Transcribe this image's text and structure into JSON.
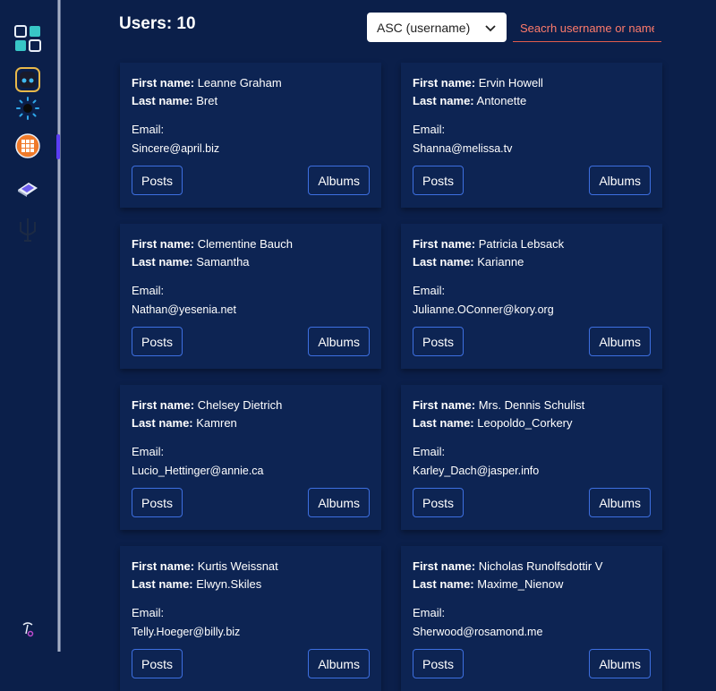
{
  "header": {
    "title": "Users: 10",
    "sort_value": "ASC (username)",
    "search_placeholder": "Seacrh username or name"
  },
  "sidebar": {
    "items": [
      {
        "icon": "grid-apps-icon"
      },
      {
        "icon": "robot-icon"
      },
      {
        "icon": "sun-icon"
      },
      {
        "icon": "calculator-icon"
      },
      {
        "icon": "book-icon"
      },
      {
        "icon": "trident-icon"
      },
      {
        "icon": "user-icon"
      }
    ]
  },
  "labels": {
    "first_name": "First name:",
    "last_name": "Last name:",
    "email": "Email:",
    "posts": "Posts",
    "albums": "Albums"
  },
  "users": [
    {
      "first": "Leanne Graham",
      "last": "Bret",
      "email": "Sincere@april.biz"
    },
    {
      "first": "Ervin Howell",
      "last": "Antonette",
      "email": "Shanna@melissa.tv"
    },
    {
      "first": "Clementine Bauch",
      "last": "Samantha",
      "email": "Nathan@yesenia.net"
    },
    {
      "first": "Patricia Lebsack",
      "last": "Karianne",
      "email": "Julianne.OConner@kory.org"
    },
    {
      "first": "Chelsey Dietrich",
      "last": "Kamren",
      "email": "Lucio_Hettinger@annie.ca"
    },
    {
      "first": "Mrs. Dennis Schulist",
      "last": "Leopoldo_Corkery",
      "email": "Karley_Dach@jasper.info"
    },
    {
      "first": "Kurtis Weissnat",
      "last": "Elwyn.Skiles",
      "email": "Telly.Hoeger@billy.biz"
    },
    {
      "first": "Nicholas Runolfsdottir V",
      "last": "Maxime_Nienow",
      "email": "Sherwood@rosamond.me"
    }
  ],
  "colors": {
    "background": "#0b1f4a",
    "card": "#0d2453",
    "button_border": "#3d6fe0",
    "search_accent": "#ff7b6b",
    "active_indicator": "#5b3df5"
  }
}
